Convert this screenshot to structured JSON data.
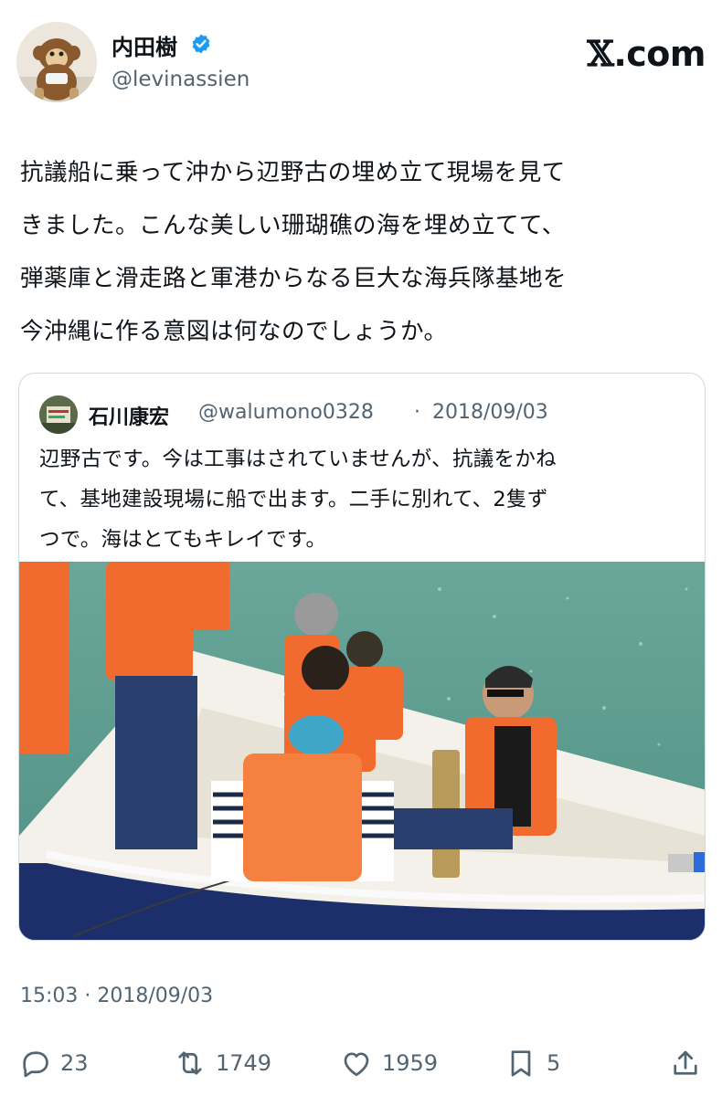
{
  "brand": {
    "logo_text": ".com",
    "logo_x": "𝕏"
  },
  "author": {
    "display_name": "内田樹",
    "handle": "@levinassien",
    "verified": true
  },
  "tweet": {
    "lines": [
      "抗議船に乗って沖から辺野古の埋め立て現場を見て",
      "きました。こんな美しい珊瑚礁の海を埋め立てて、",
      "弾薬庫と滑走路と軍港からなる巨大な海兵隊基地を",
      "今沖縄に作る意図は何なのでしょうか。"
    ],
    "timestamp": "15:03 · 2018/09/03"
  },
  "quoted": {
    "display_name": "石川康宏",
    "handle": "@walumono0328",
    "separator": "·",
    "date": "2018/09/03",
    "lines": [
      "辺野古です。今は工事はされていませんが、抗議をかね",
      "て、基地建設現場に船で出ます。二手に別れて、2隻ず",
      "つで。海はとてもキレイです。"
    ]
  },
  "actions": {
    "replies": "23",
    "reposts": "1749",
    "likes": "1959",
    "bookmarks": "5"
  },
  "colors": {
    "text": "#0f1419",
    "secondary": "#536471",
    "border": "#cfd9de",
    "verified_blue": "#1d9bf0",
    "life_jacket": "#f26b2e",
    "sea": "#5a9a8c"
  },
  "icons": [
    "verified-badge-icon",
    "reply-icon",
    "repost-icon",
    "like-icon",
    "bookmark-icon",
    "share-icon"
  ]
}
